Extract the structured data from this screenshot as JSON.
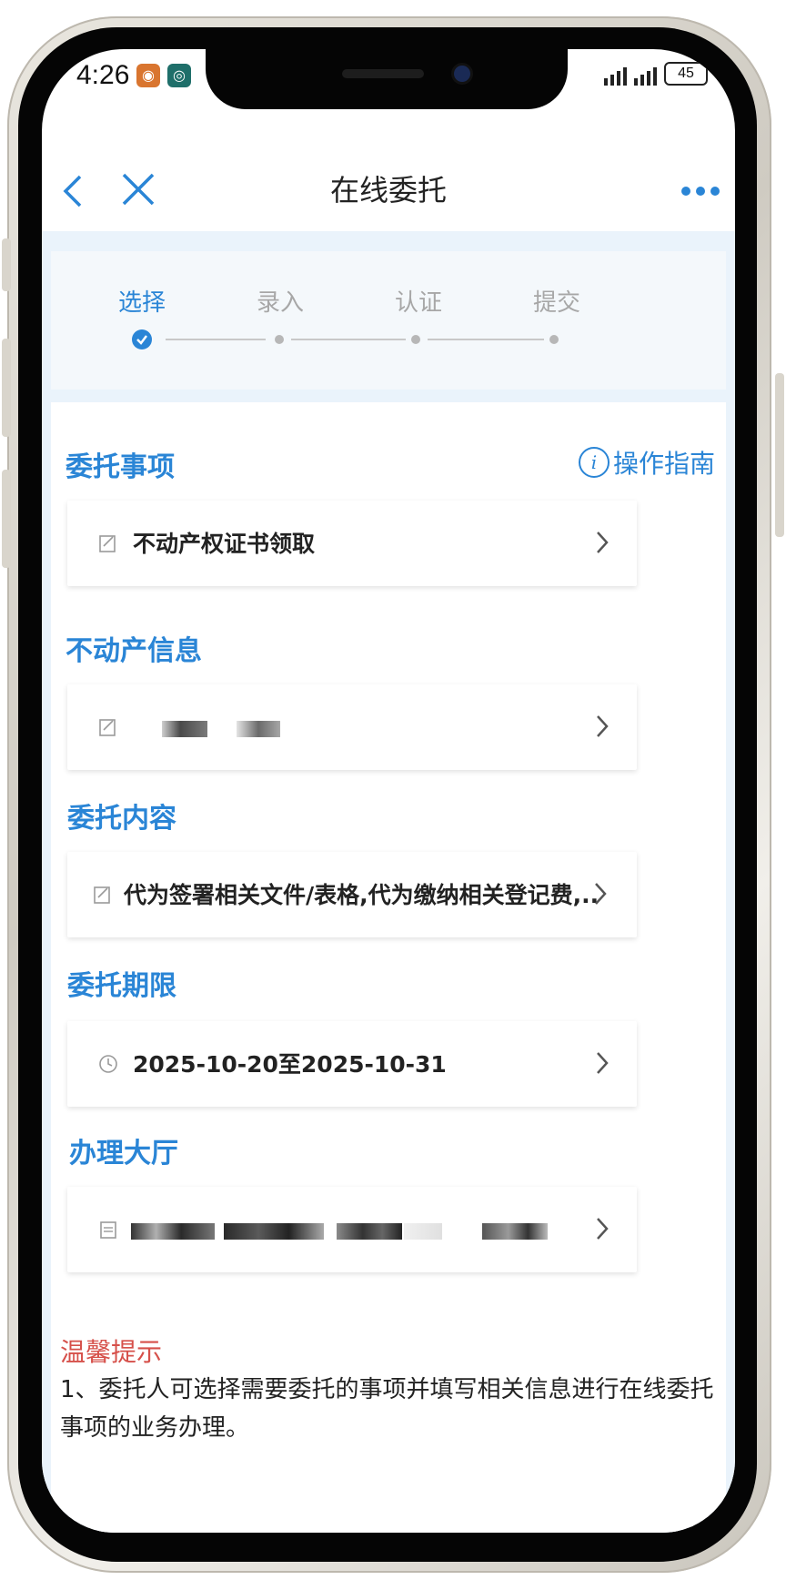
{
  "status_bar": {
    "time": "4:26",
    "battery": "45"
  },
  "nav": {
    "title": "在线委托",
    "back_icon": "chevron-left-icon",
    "close_icon": "close-icon",
    "more_icon": "more-icon"
  },
  "steps": [
    {
      "label": "选择",
      "state": "done"
    },
    {
      "label": "录入",
      "state": "pending"
    },
    {
      "label": "认证",
      "state": "pending"
    },
    {
      "label": "提交",
      "state": "pending"
    }
  ],
  "guide": {
    "label": "操作指南"
  },
  "sections": {
    "matter": {
      "title": "委托事项",
      "value": "不动产权证书领取"
    },
    "property": {
      "title": "不动产信息",
      "value": ""
    },
    "content": {
      "title": "委托内容",
      "value": "代为签署相关文件/表格,代为缴纳相关登记费,..."
    },
    "period": {
      "title": "委托期限",
      "value": "2025-10-20至2025-10-31"
    },
    "hall": {
      "title": "办理大厅",
      "value": ""
    }
  },
  "tips": {
    "title": "温馨提示",
    "text": "1、委托人可选择需要委托的事项并填写相关信息进行在线委托事项的业务办理。"
  },
  "colors": {
    "accent": "#2a85d6",
    "warning": "#d6504a",
    "page_bg": "#eaf3fb"
  }
}
